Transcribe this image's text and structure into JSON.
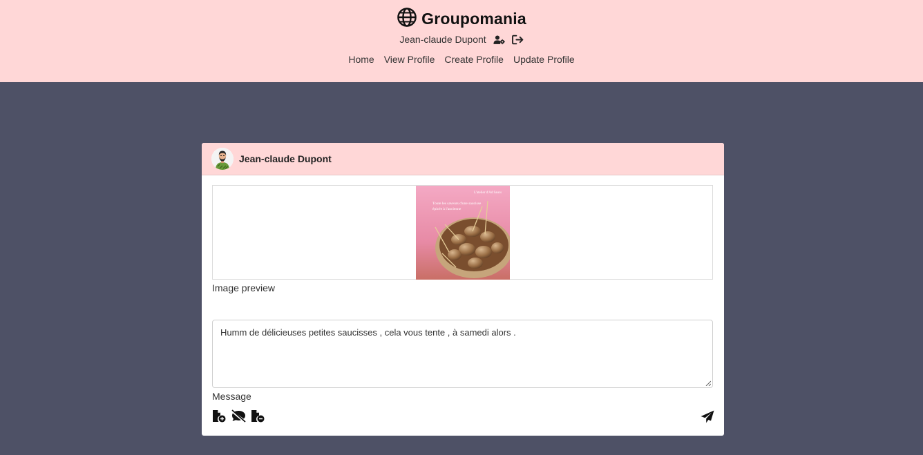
{
  "header": {
    "brand": "Groupomania",
    "brand_icon": "globe-icon",
    "user_name": "Jean-claude Dupont",
    "user_settings_icon": "user-gear-icon",
    "logout_icon": "logout-icon",
    "nav": [
      {
        "label": "Home"
      },
      {
        "label": "View Profile"
      },
      {
        "label": "Create Profile"
      },
      {
        "label": "Update Profile"
      }
    ]
  },
  "post_form": {
    "author": "Jean-claude Dupont",
    "image_preview_label": "Image preview",
    "image_caption": "L'atelier d'Ad Saucs",
    "image_overlay_text": "Toute les saveurs d'une saucisse épicée à l'ancienne",
    "message_value": "Humm de délicieuses petites saucisses , cela vous tente , à samedi alors .",
    "message_label": "Message",
    "action_icons": [
      "file-add-icon",
      "comment-slash-icon",
      "file-remove-icon"
    ],
    "send_icon": "paper-plane-icon"
  },
  "colors": {
    "header_bg": "#ffd7d7",
    "page_bg": "#4e5166",
    "card_bg": "#ffffff"
  }
}
